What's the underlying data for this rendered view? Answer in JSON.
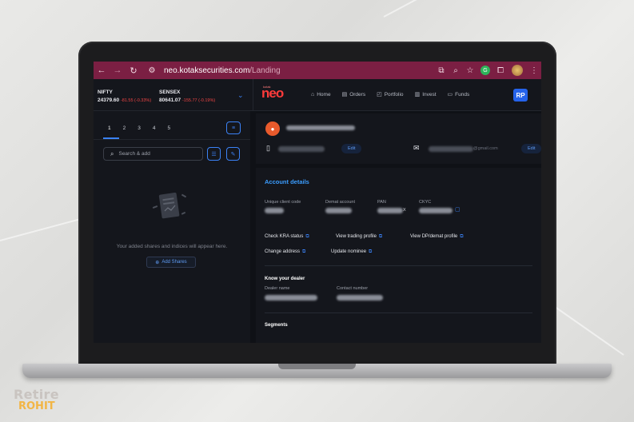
{
  "browser": {
    "url_host": "neo.kotaksecurities.com",
    "url_path": "/Landing"
  },
  "tickers": [
    {
      "name": "NIFTY",
      "value": "24379.60",
      "change": "-81.55 (-0.33%)"
    },
    {
      "name": "SENSEX",
      "value": "80641.07",
      "change": "-155.77 (-0.19%)"
    }
  ],
  "app": {
    "logo": "neo",
    "logo_tag": "kotak",
    "avatar_initials": "RP"
  },
  "menu": [
    {
      "label": "Home",
      "icon": "home-icon",
      "glyph": "⌂"
    },
    {
      "label": "Orders",
      "icon": "orders-icon",
      "glyph": "▤"
    },
    {
      "label": "Portfolio",
      "icon": "portfolio-icon",
      "glyph": "◰"
    },
    {
      "label": "Invest",
      "icon": "invest-icon",
      "glyph": "▥"
    },
    {
      "label": "Funds",
      "icon": "funds-icon",
      "glyph": "▭"
    }
  ],
  "watchlist": {
    "tabs": [
      "1",
      "2",
      "3",
      "4",
      "5"
    ],
    "active_tab": "1",
    "search_placeholder": "Search & add",
    "empty_message": "Your added shares and indices will appear here.",
    "add_button": "Add Shares"
  },
  "profile": {
    "edit_label": "Edit",
    "email_suffix": "@gmail.com",
    "edit_label_2": "Edit"
  },
  "account_details": {
    "title": "Account details",
    "fields": [
      "Unique client code",
      "Demat account",
      "PAN",
      "CKYC"
    ],
    "pan_suffix": "X",
    "links_row1": [
      "Check KRA status",
      "View trading profile",
      "View DP/demat profile"
    ],
    "links_row2": [
      "Change address",
      "Update nominee"
    ],
    "dealer_title": "Know your dealer",
    "dealer_fields": [
      "Dealer name",
      "Contact number"
    ],
    "segments_title": "Segments"
  },
  "watermark": {
    "line1": "Retire",
    "line2": "ROHIT"
  },
  "colors": {
    "browser_bar": "#7b1f43",
    "accent_blue": "#3b82f6",
    "neo_red": "#ff3b3b",
    "negative": "#ef4444"
  }
}
